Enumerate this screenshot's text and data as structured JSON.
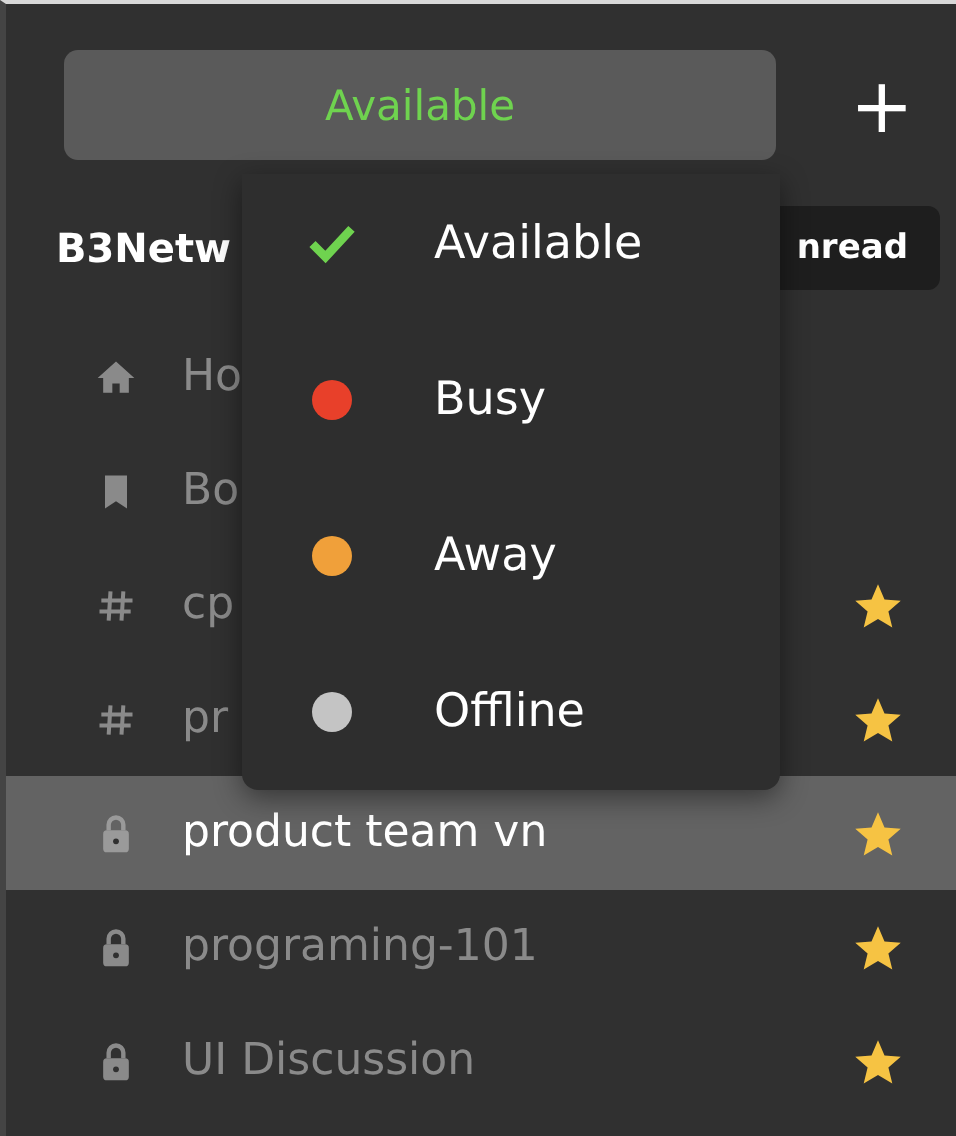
{
  "status_button": {
    "label": "Available"
  },
  "add_button": {
    "label": "+"
  },
  "workspace": {
    "name": "B3Netw",
    "badge": "nread"
  },
  "sidebar": {
    "items": [
      {
        "kind": "home",
        "label": "Ho",
        "selected": false,
        "starred": false
      },
      {
        "kind": "bookmark",
        "label": "Bo",
        "selected": false,
        "starred": false
      },
      {
        "kind": "channel",
        "label": "cp",
        "selected": false,
        "starred": true
      },
      {
        "kind": "channel",
        "label": "pr",
        "selected": false,
        "starred": true
      },
      {
        "kind": "private",
        "label": "product team vn",
        "selected": true,
        "starred": true
      },
      {
        "kind": "private",
        "label": "programing-101",
        "selected": false,
        "starred": true
      },
      {
        "kind": "private",
        "label": "UI Discussion",
        "selected": false,
        "starred": true
      }
    ]
  },
  "status_menu": {
    "items": [
      {
        "label": "Available",
        "selected": true,
        "color": "#6fd34f"
      },
      {
        "label": "Busy",
        "selected": false,
        "color": "#e8402a"
      },
      {
        "label": "Away",
        "selected": false,
        "color": "#f0a03a"
      },
      {
        "label": "Offline",
        "selected": false,
        "color": "#c4c4c4"
      }
    ]
  }
}
